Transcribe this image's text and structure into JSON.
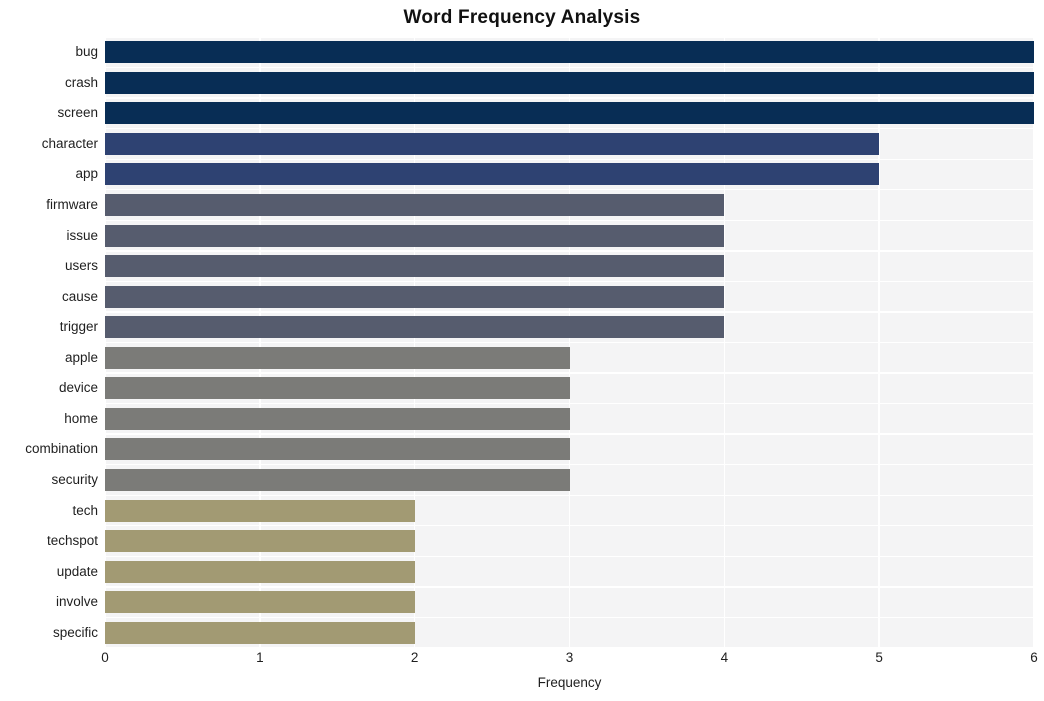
{
  "chart_data": {
    "type": "bar",
    "orientation": "horizontal",
    "title": "Word Frequency Analysis",
    "xlabel": "Frequency",
    "ylabel": "",
    "xlim": [
      0,
      6
    ],
    "ylim": null,
    "grid": true,
    "legend": null,
    "xticks": [
      "0",
      "1",
      "2",
      "3",
      "4",
      "5",
      "6"
    ],
    "xtick_values": [
      0,
      1,
      2,
      3,
      4,
      5,
      6
    ],
    "categories": [
      "bug",
      "crash",
      "screen",
      "character",
      "app",
      "firmware",
      "issue",
      "users",
      "cause",
      "trigger",
      "apple",
      "device",
      "home",
      "combination",
      "security",
      "tech",
      "techspot",
      "update",
      "involve",
      "specific"
    ],
    "values": [
      6,
      6,
      6,
      5,
      5,
      4,
      4,
      4,
      4,
      4,
      3,
      3,
      3,
      3,
      3,
      2,
      2,
      2,
      2,
      2
    ],
    "bar_colors": [
      "#082d55",
      "#082d55",
      "#082d55",
      "#2e4272",
      "#2e4272",
      "#565c6e",
      "#565c6e",
      "#565c6e",
      "#565c6e",
      "#565c6e",
      "#7b7b78",
      "#7b7b78",
      "#7b7b78",
      "#7b7b78",
      "#7b7b78",
      "#a29a73",
      "#a29a73",
      "#a29a73",
      "#a29a73",
      "#a29a73"
    ],
    "plot_background": "#f4f4f5",
    "grid_color": "#ffffff",
    "figure_background": "#ffffff"
  }
}
